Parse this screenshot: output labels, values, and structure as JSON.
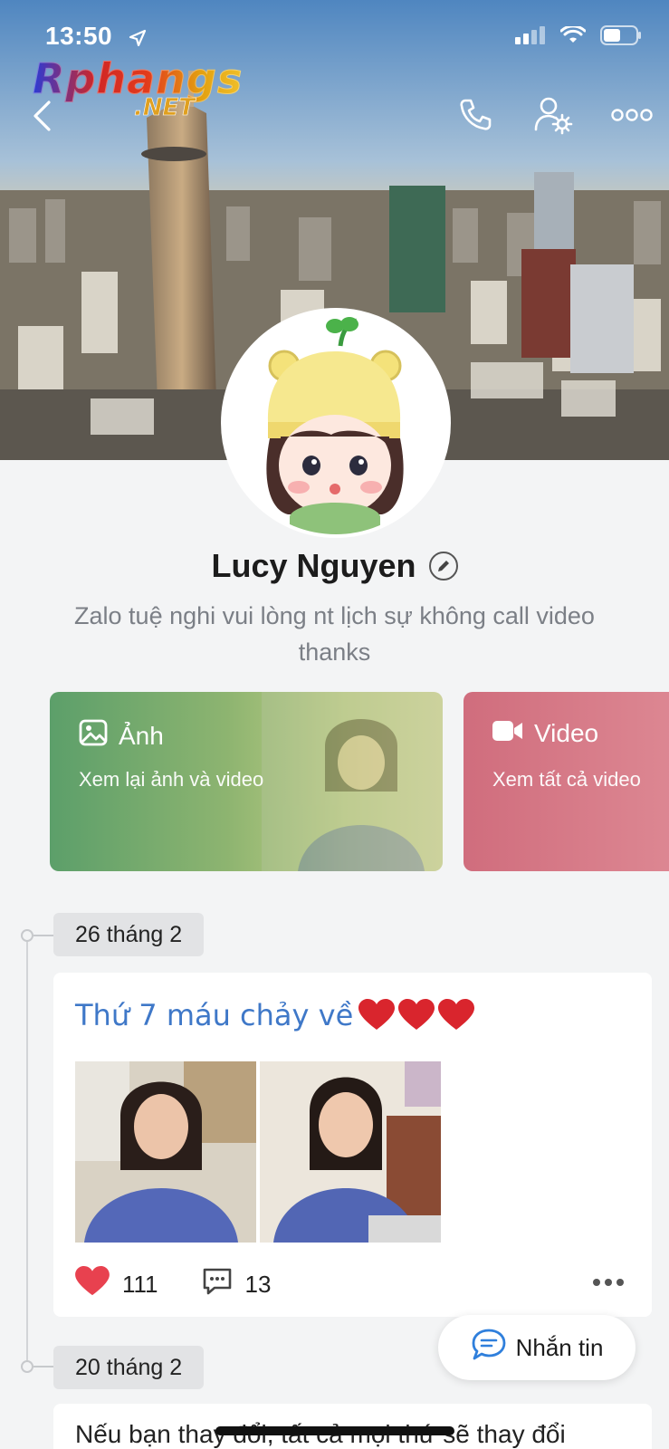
{
  "status_bar": {
    "time": "13:50"
  },
  "watermark": {
    "brand_main": "Rphangs",
    "brand_sub": ".NET"
  },
  "header": {
    "back_icon": "chevron-left-icon",
    "call_icon": "phone-icon",
    "settings_icon": "user-gear-icon",
    "more_icon": "more-horizontal-icon"
  },
  "profile": {
    "name": "Lucy Nguyen",
    "bio": "Zalo tuệ nghi vui lòng nt lịch sự không call video thanks"
  },
  "media_cards": [
    {
      "title": "Ảnh",
      "subtitle": "Xem lại ảnh và video",
      "icon": "image-icon",
      "color": "#6aa46f"
    },
    {
      "title": "Video",
      "subtitle": "Xem tất cả video",
      "icon": "video-icon",
      "color": "#d06d7d"
    }
  ],
  "timeline": [
    {
      "date": "26 tháng 2",
      "caption": "Thứ 7 máu chảy về",
      "likes": "111",
      "comments": "13"
    },
    {
      "date": "20 tháng 2",
      "caption": "Nếu bạn thay đổi, tất cả mọi thứ sẽ thay đổi"
    }
  ],
  "message_button": {
    "label": "Nhắn tin"
  },
  "colors": {
    "accent": "#3f78c8",
    "like": "#e8414f"
  }
}
